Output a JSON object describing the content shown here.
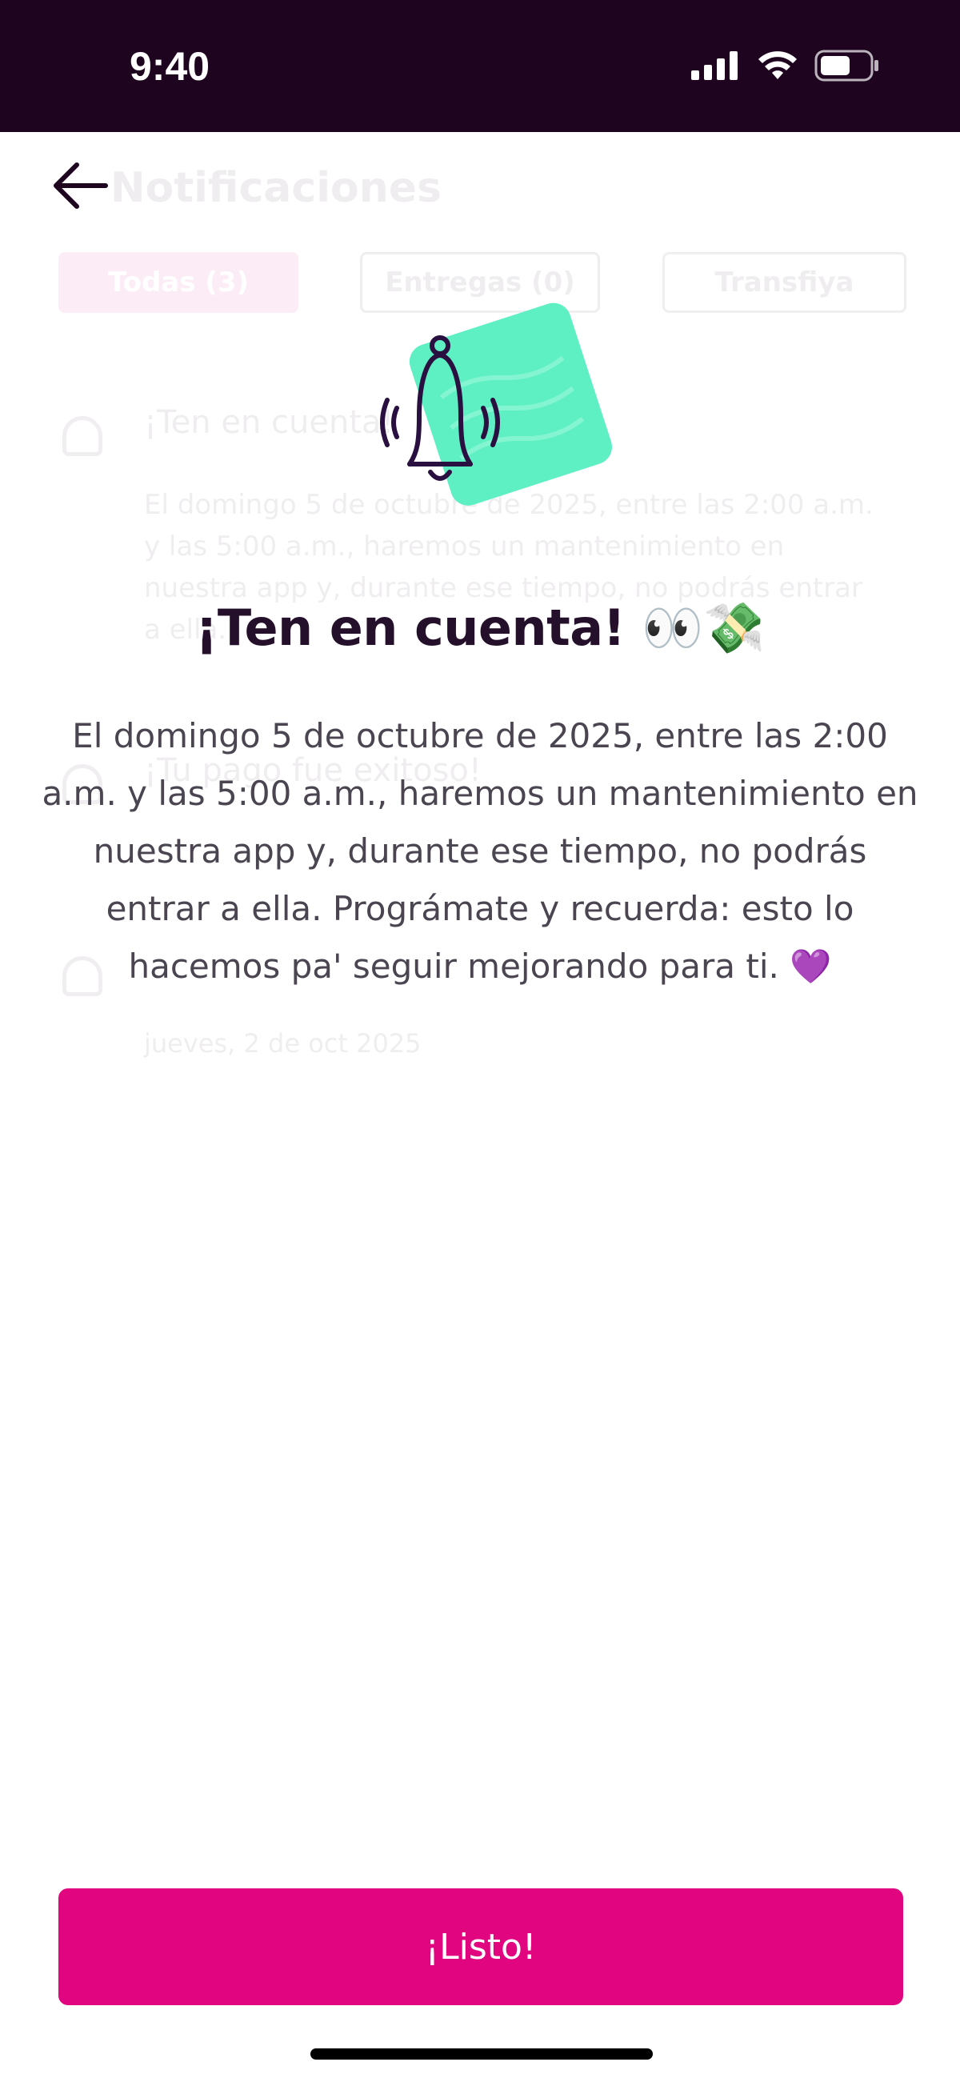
{
  "status_bar": {
    "time": "9:40",
    "icons": [
      "cellular-signal-icon",
      "wifi-icon",
      "battery-icon"
    ]
  },
  "background": {
    "title": "Notificaciones",
    "tabs": [
      {
        "label": "Todas (3)",
        "active": true
      },
      {
        "label": "Entregas (0)",
        "active": false
      },
      {
        "label": "Transfiya",
        "active": false
      }
    ],
    "items": [
      {
        "title": "¡Ten en cuenta!",
        "text": "El domingo 5 de octubre de 2025, entre las 2:00 a.m. y las 5:00 a.m., haremos un mantenimiento en nuestra app y, durante ese tiempo, no podrás entrar a ella."
      },
      {
        "title": "¡Tu pago fue exitoso!",
        "text": ""
      },
      {
        "title": "",
        "text": "",
        "date": "jueves, 2 de oct 2025"
      }
    ]
  },
  "modal": {
    "illustration_icon": "bell-ringing-icon",
    "headline": "¡Ten en cuenta! 👀💸",
    "body": "El domingo 5 de octubre de 2025, entre las 2:00 a.m. y las 5:00 a.m., haremos un mantenimiento en nuestra app y, durante ese tiempo, no podrás entrar a ella. Prográmate y recuerda: esto lo hacemos pa' seguir mejorando para ti. 💜",
    "button_label": "¡Listo!"
  },
  "colors": {
    "status_bar_bg": "#1f0420",
    "accent": "#e1057f",
    "illustration_green": "#5ef0c3",
    "headline": "#24102a",
    "body_text": "#4a4550"
  }
}
